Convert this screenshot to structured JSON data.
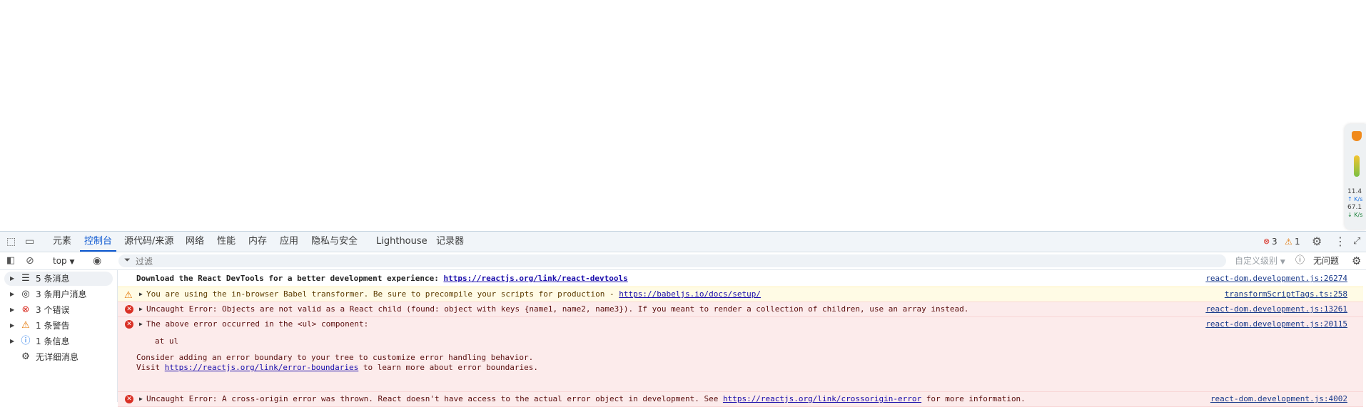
{
  "tabs": [
    "元素",
    "控制台",
    "源代码/来源",
    "网络",
    "性能",
    "内存",
    "应用",
    "隐私与安全",
    "Lighthouse",
    "记录器"
  ],
  "tab_active_index": 1,
  "header_counts": {
    "errors": "3",
    "warnings": "1"
  },
  "filterbar": {
    "context": "top",
    "filter_placeholder": "过滤",
    "levels": "自定义级别",
    "issues": "无问题"
  },
  "sidebar": [
    {
      "label": "5 条消息",
      "icon": "list-icon"
    },
    {
      "label": "3 条用户消息",
      "icon": "user-icon"
    },
    {
      "label": "3 个错误",
      "icon": "error-icon"
    },
    {
      "label": "1 条警告",
      "icon": "warning-icon"
    },
    {
      "label": "1 条信息",
      "icon": "info-icon"
    },
    {
      "label": "无详细消息",
      "icon": "bug-icon"
    }
  ],
  "console": {
    "m0": {
      "text": "Download the React DevTools for a better development experience: ",
      "link": "https://reactjs.org/link/react-devtools",
      "source": "react-dom.development.js:26274"
    },
    "m1": {
      "text": "You are using the in-browser Babel transformer. Be sure to precompile your scripts for production - ",
      "link": "https://babeljs.io/docs/setup/",
      "source": "transformScriptTags.ts:258"
    },
    "m2": {
      "text": "Uncaught Error: Objects are not valid as a React child (found: object with keys {name1, name2, name3}). If you meant to render a collection of children, use an array instead.",
      "source": "react-dom.development.js:13261"
    },
    "m3": {
      "text": "The above error occurred in the <ul> component:",
      "stack": "at ul",
      "consider": "Consider adding an error boundary to your tree to customize error handling behavior.",
      "visit_pre": "Visit ",
      "visit_link": "https://reactjs.org/link/error-boundaries",
      "visit_post": " to learn more about error boundaries.",
      "source": "react-dom.development.js:20115"
    },
    "m4": {
      "text": "Uncaught Error: A cross-origin error was thrown. React doesn't have access to the actual error object in development. See ",
      "link": "https://reactjs.org/link/crossorigin-error",
      "post": " for more information.",
      "source": "react-dom.development.js:4002"
    }
  },
  "widget": {
    "stat1": "11.4",
    "unit1": "↑ K/s",
    "stat2": "67.1",
    "unit2": "↓ K/s"
  },
  "colors": {
    "accent": "#0b57d0",
    "error": "#d93025",
    "warning": "#e37400",
    "error_bg": "#fcebeb",
    "warning_bg": "#fffbe5"
  }
}
